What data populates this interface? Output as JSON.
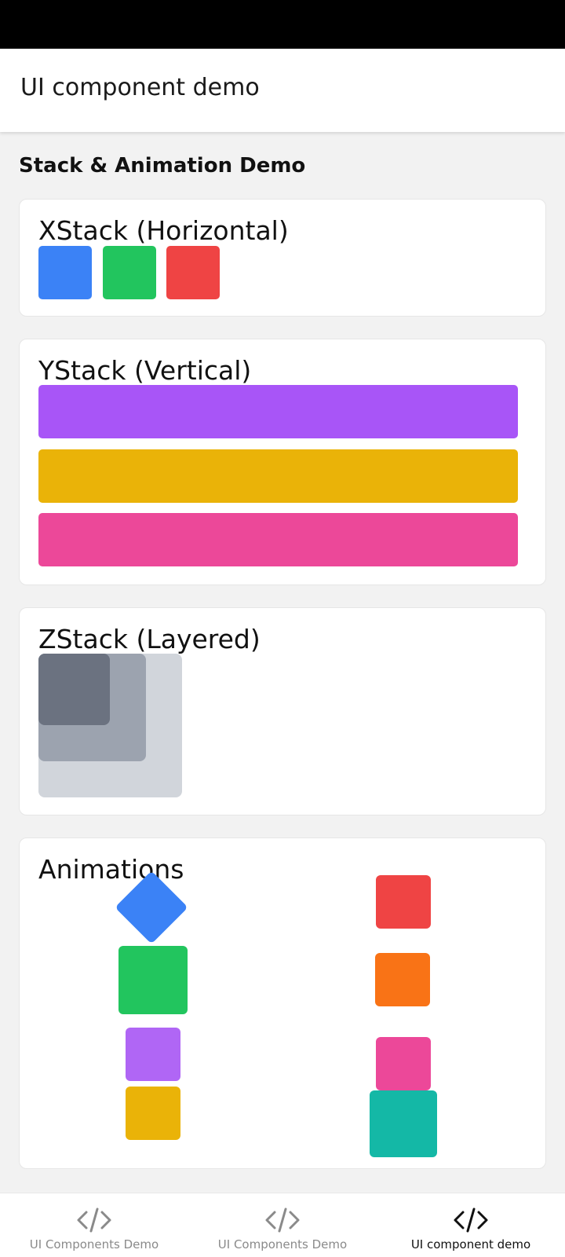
{
  "header": {
    "title": "UI component demo"
  },
  "page": {
    "section_title": "Stack & Animation Demo"
  },
  "xstack": {
    "title": "XStack (Horizontal)",
    "colors": [
      "#3b82f6",
      "#22c55e",
      "#ef4444"
    ]
  },
  "ystack": {
    "title": "YStack (Vertical)",
    "colors": [
      "#a855f7",
      "#eab308",
      "#ec4899"
    ]
  },
  "zstack": {
    "title": "ZStack (Layered)",
    "colors": [
      "#d1d5db",
      "#9ca3af",
      "#6b7280"
    ]
  },
  "animations": {
    "title": "Animations",
    "colors": [
      "#3b82f6",
      "#22c55e",
      "#b066f5",
      "#eab308",
      "#ef4444",
      "#f97316",
      "#ec4899",
      "#14b8a6"
    ]
  },
  "bottom_nav": {
    "items": [
      {
        "label": "UI Components Demo",
        "icon": "code-icon",
        "active": false
      },
      {
        "label": "UI Components Demo",
        "icon": "code-icon",
        "active": false
      },
      {
        "label": "UI component demo",
        "icon": "code-icon",
        "active": true
      }
    ]
  }
}
